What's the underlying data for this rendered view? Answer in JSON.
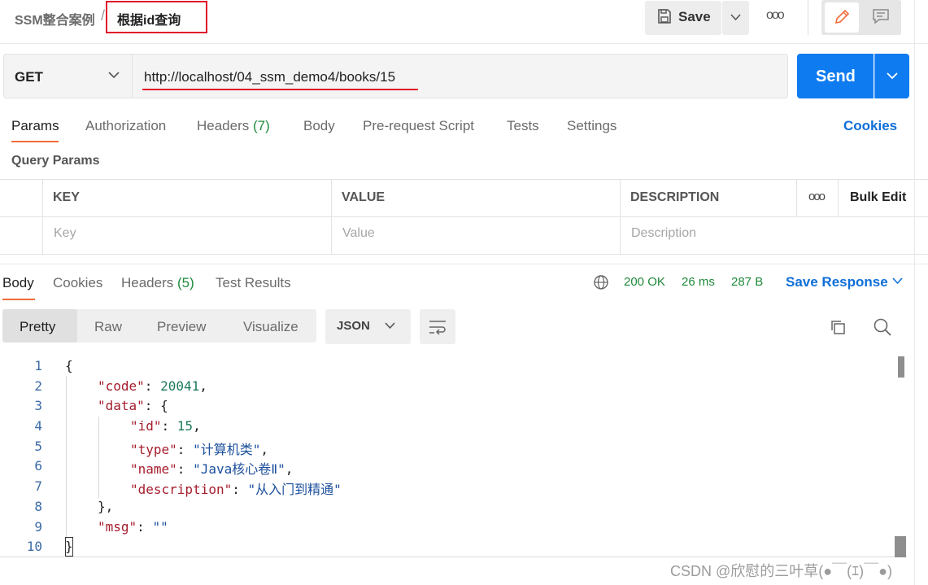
{
  "breadcrumb": {
    "parent": "SSM整合案例",
    "separator": "/",
    "title": "根据id查询"
  },
  "toolbar": {
    "save_label": "Save",
    "more_label": "ooo"
  },
  "request": {
    "method": "GET",
    "url": "http://localhost/04_ssm_demo4/books/15",
    "send_label": "Send"
  },
  "request_tabs": {
    "params": "Params",
    "authorization": "Authorization",
    "headers": "Headers",
    "headers_count": "(7)",
    "body": "Body",
    "prerequest": "Pre-request Script",
    "tests": "Tests",
    "settings": "Settings",
    "cookies": "Cookies"
  },
  "query_params": {
    "title": "Query Params",
    "columns": {
      "key": "KEY",
      "value": "VALUE",
      "description": "DESCRIPTION"
    },
    "more": "ooo",
    "bulk_edit": "Bulk Edit",
    "placeholders": {
      "key": "Key",
      "value": "Value",
      "description": "Description"
    }
  },
  "response_tabs": {
    "body": "Body",
    "cookies": "Cookies",
    "headers": "Headers",
    "headers_count": "(5)",
    "test_results": "Test Results"
  },
  "response_status": {
    "code": "200 OK",
    "time": "26 ms",
    "size": "287 B",
    "save_response": "Save Response"
  },
  "view": {
    "pretty": "Pretty",
    "raw": "Raw",
    "preview": "Preview",
    "visualize": "Visualize",
    "format": "JSON"
  },
  "code": {
    "line_numbers": [
      "1",
      "2",
      "3",
      "4",
      "5",
      "6",
      "7",
      "8",
      "9",
      "10"
    ],
    "lines": [
      {
        "open": "{"
      },
      {
        "key": "\"code\"",
        "sep": ": ",
        "num": "20041",
        "end": ","
      },
      {
        "key": "\"data\"",
        "sep": ": ",
        "end": "{"
      },
      {
        "key": "\"id\"",
        "sep": ": ",
        "num": "15",
        "end": ","
      },
      {
        "key": "\"type\"",
        "sep": ": ",
        "str": "\"计算机类\"",
        "end": ","
      },
      {
        "key": "\"name\"",
        "sep": ": ",
        "str": "\"Java核心卷Ⅱ\"",
        "end": ","
      },
      {
        "key": "\"description\"",
        "sep": ": ",
        "str": "\"从入门到精通\""
      },
      {
        "close": "},"
      },
      {
        "key": "\"msg\"",
        "sep": ": ",
        "str": "\"\""
      },
      {
        "close": "}"
      }
    ]
  },
  "watermark": "CSDN @欣慰的三叶草(●￣(ｴ)￣●)",
  "colors": {
    "send_blue": "#0f7bf0",
    "status_green": "#1f8a3b",
    "link_blue": "#0f6fd8",
    "highlight_red": "#e0162b",
    "active_tab_orange": "#f26b3a"
  }
}
